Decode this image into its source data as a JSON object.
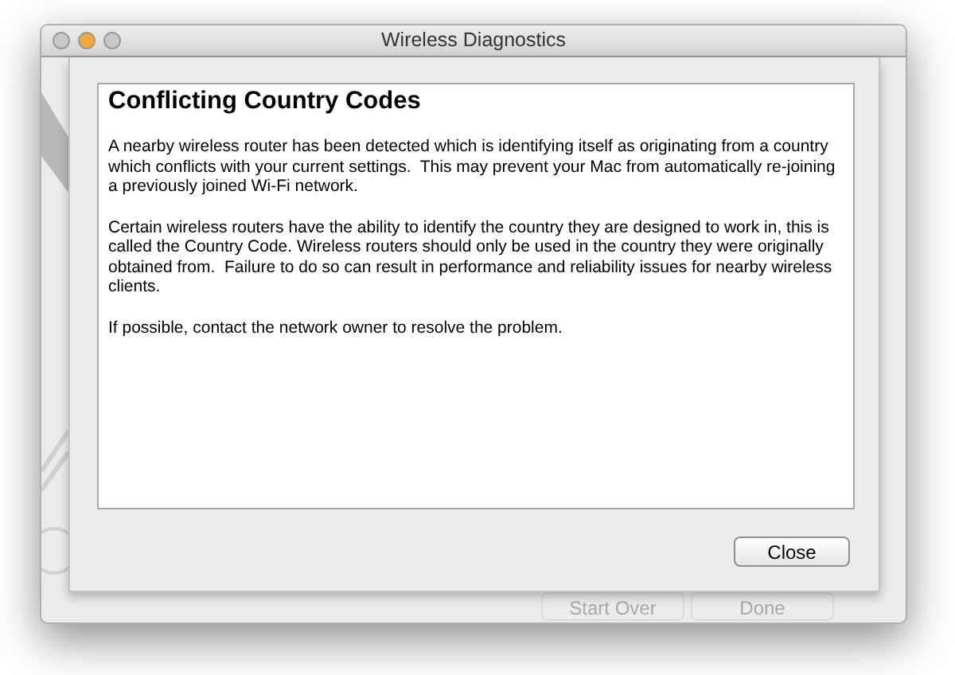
{
  "window": {
    "title": "Wireless Diagnostics",
    "traffic_lights": [
      {
        "color": "#c8c8c8"
      },
      {
        "color": "#f2a93b"
      },
      {
        "color": "#c8c8c8"
      }
    ]
  },
  "sheet": {
    "heading": "Conflicting Country Codes",
    "paragraphs": [
      "A nearby wireless router has been detected which is identifying itself as originating from a country which conflicts with your current settings.  This may prevent your Mac from automatically re-joining a previously joined Wi-Fi network.",
      "Certain wireless routers have the ability to identify the country they are designed to work in, this is called the Country Code. Wireless routers should only be used in the country they were originally obtained from.  Failure to do so can result in performance and reliability issues for nearby wireless clients.",
      "If possible, contact the network owner to resolve the problem."
    ],
    "button": "Close"
  },
  "background_buttons": [
    {
      "label": "Start Over",
      "disabled": true
    },
    {
      "label": "Done",
      "disabled": true
    }
  ]
}
